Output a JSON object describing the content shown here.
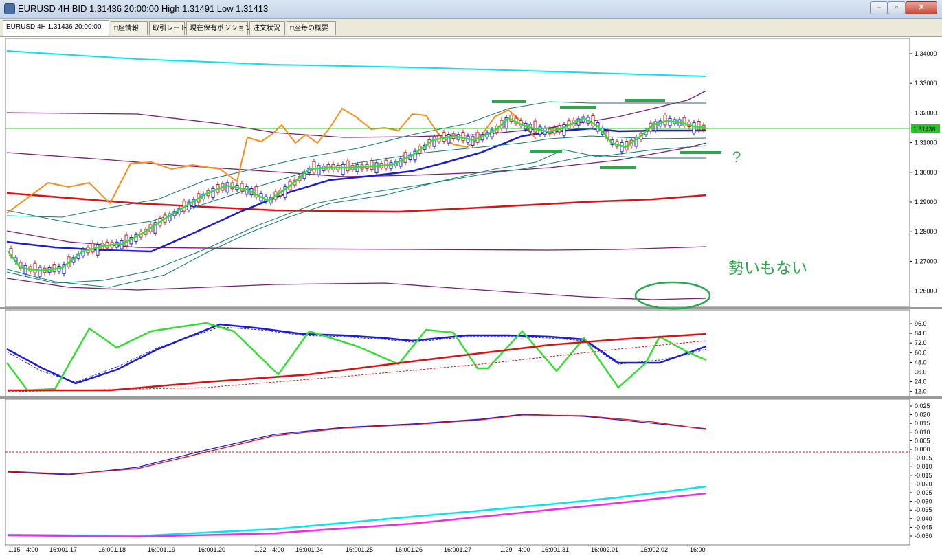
{
  "window": {
    "title": "EURUSD 4H BID 1.31436 20:00:00 High 1.31491 Low 1.31413",
    "min_symbol": "‒",
    "max_symbol": "▫",
    "close_symbol": "✕"
  },
  "tabs": [
    {
      "label": "EURUSD 4H 1.31436 20:00:00"
    },
    {
      "label": "□座情報"
    },
    {
      "label": "取引レート"
    },
    {
      "label": "現在保有ポジション"
    },
    {
      "label": "注文状況"
    },
    {
      "label": "□座毎の概要"
    }
  ],
  "price_axis": {
    "labels": [
      "1.34000",
      "1.33000",
      "1.32000",
      "1.31000",
      "1.30000",
      "1.29000",
      "1.28000",
      "1.27000",
      "1.26000"
    ],
    "current_price_tag": "1.31436"
  },
  "stoch_axis": {
    "labels": [
      "96.0",
      "84.0",
      "72.0",
      "60.0",
      "48.0",
      "36.0",
      "24.0",
      "12.0"
    ]
  },
  "macd_axis": {
    "labels": [
      "0.025",
      "0.020",
      "0.015",
      "0.010",
      "0.005",
      "0.000",
      "-0.005",
      "-0.010",
      "-0.015",
      "-0.020",
      "-0.025",
      "-0.030",
      "-0.035",
      "-0.040",
      "-0.045",
      "-0.050"
    ]
  },
  "time_axis": {
    "labels": [
      "1.15",
      "4:00",
      "16:001.17",
      "16:001.18",
      "16:001.19",
      "16:001.20",
      "1.22",
      "4:00",
      "16:001.24",
      "16:001.25",
      "16:001.26",
      "16:001.27",
      "1.29",
      "4:00",
      "16:001.31",
      "16:002.01",
      "16:002.02",
      "16:00"
    ]
  },
  "annotations": {
    "question_mark": "?",
    "momentum_text": "勢いもない"
  },
  "colors": {
    "cyan_line": "#00e5ee",
    "orange_line": "#ff8c1a",
    "red_ma": "#e01010",
    "blue_ma": "#1a1adc",
    "green_ma": "#33dd33",
    "bollinger": "#0e7a6e",
    "purple_env": "#7a1a7a",
    "annotation_green": "#2aa84a",
    "magenta_line": "#ff22ee",
    "current_price_line": "#22c722"
  }
}
